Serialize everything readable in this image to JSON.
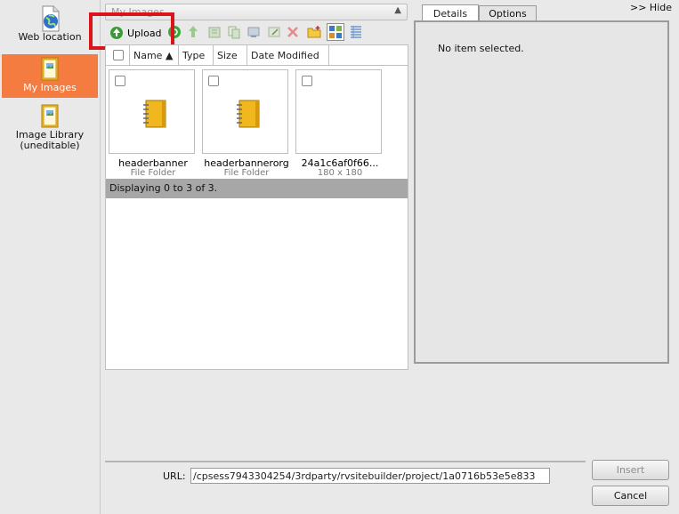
{
  "sidebar": {
    "items": [
      {
        "label": "Web location",
        "icon": "web-location-icon",
        "active": false
      },
      {
        "label": "My Images",
        "icon": "folder-images-icon",
        "active": true
      },
      {
        "label": "Image Library (uneditable)",
        "icon": "library-icon",
        "active": false
      }
    ]
  },
  "folder_select": {
    "value": "My Images"
  },
  "toolbar": {
    "upload_label": "Upload",
    "icons": [
      "upload-icon",
      "refresh-icon",
      "up-folder-icon",
      "cut-icon",
      "copy-icon",
      "paste-icon",
      "rename-icon",
      "delete-icon",
      "new-folder-icon",
      "thumbnail-view-icon",
      "list-view-icon"
    ]
  },
  "list": {
    "columns": [
      "Name ▲",
      "Type",
      "Size",
      "Date Modified"
    ],
    "items": [
      {
        "name": "headerbanner",
        "sub": "File Folder"
      },
      {
        "name": "headerbannerorg",
        "sub": "File Folder"
      },
      {
        "name": "24a1c6af0f66...",
        "sub": "180 x 180"
      }
    ],
    "status": "Displaying 0 to 3 of 3."
  },
  "right_panel": {
    "hide_label": ">> Hide",
    "tabs": [
      "Details",
      "Options"
    ],
    "empty_message": "No item selected."
  },
  "bottom": {
    "url_label": "URL:",
    "url_value": "/cpsess7943304254/3rdparty/rvsitebuilder/project/1a0716b53e5e833",
    "insert_label": "Insert",
    "cancel_label": "Cancel"
  },
  "colors": {
    "active": "#f47c41",
    "highlight": "#d9151b",
    "status_bar": "#a7a7a7"
  }
}
